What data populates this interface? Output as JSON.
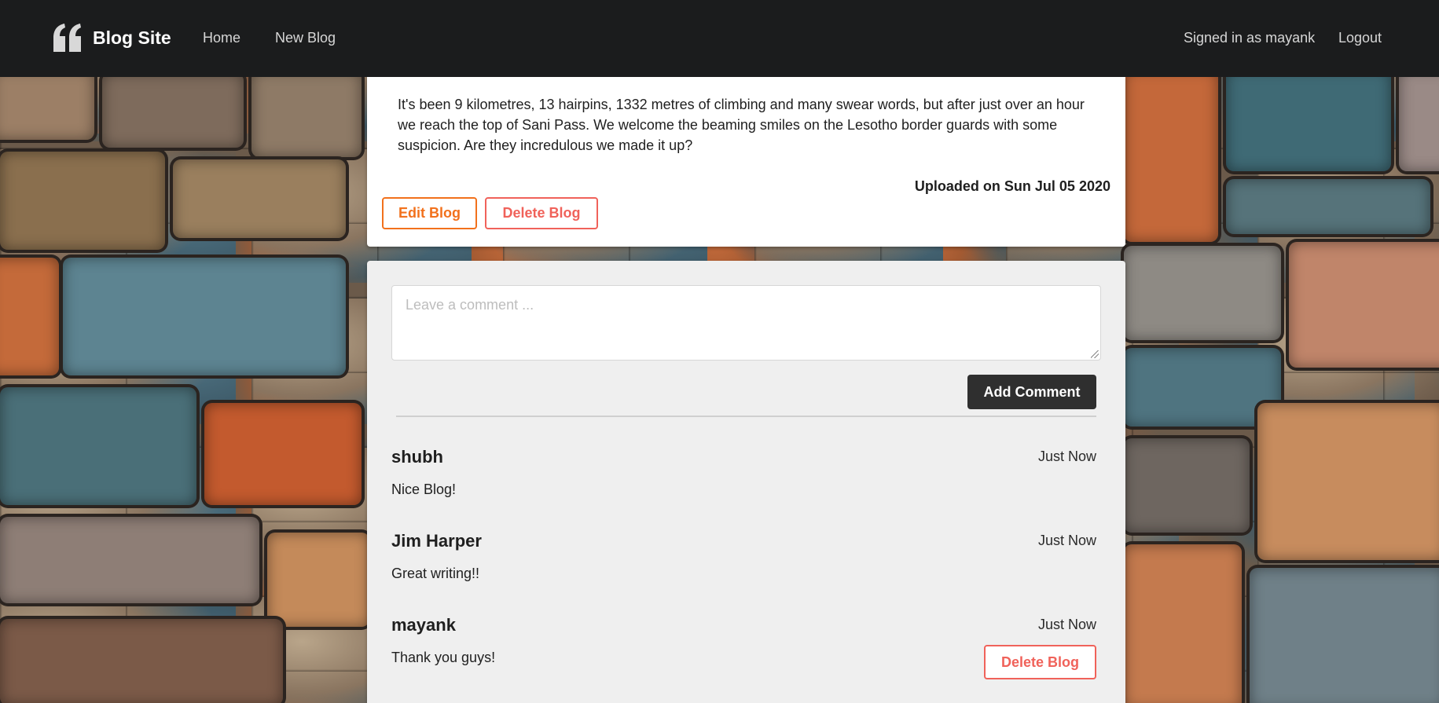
{
  "navbar": {
    "brand": "Blog Site",
    "links": {
      "home": "Home",
      "new_blog": "New Blog",
      "signed_in": "Signed in as mayank",
      "logout": "Logout"
    }
  },
  "post": {
    "body": "It's been 9 kilometres, 13 hairpins, 1332 metres of climbing and many swear words, but after just over an hour we reach the top of Sani Pass. We welcome the beaming smiles on the Lesotho border guards with some suspicion. Are they incredulous we made it up?",
    "uploaded": "Uploaded on Sun Jul 05 2020",
    "edit_label": "Edit Blog",
    "delete_label": "Delete Blog"
  },
  "comments_section": {
    "placeholder": "Leave a comment ...",
    "add_label": "Add Comment",
    "comments": [
      {
        "author": "shubh",
        "time": "Just Now",
        "text": "Nice Blog!"
      },
      {
        "author": "Jim Harper",
        "time": "Just Now",
        "text": "Great writing!!"
      },
      {
        "author": "mayank",
        "time": "Just Now",
        "text": "Thank you guys!",
        "delete_label": "Delete Blog"
      }
    ]
  },
  "colors": {
    "navbar": "#1b1c1d",
    "orange": "#f2711c",
    "red": "#f0625a",
    "dark_button": "#2f2f2f"
  }
}
